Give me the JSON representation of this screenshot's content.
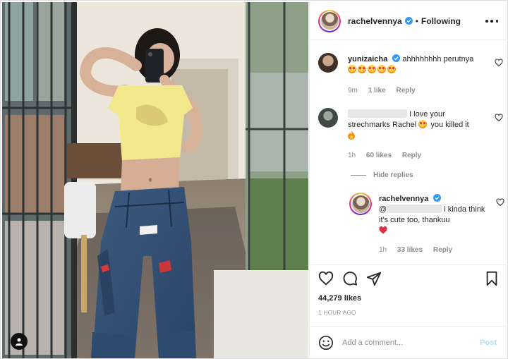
{
  "post": {
    "username": "rachelvennya",
    "separator": "•",
    "follow_status": "Following",
    "likes": "44,279 likes",
    "time_ago": "1 HOUR AGO"
  },
  "comments": [
    {
      "username": "yunizaicha",
      "text": "ahhhhhhhh perutnya",
      "emojis": [
        "star-struck",
        "star-struck",
        "star-struck",
        "star-struck",
        "star-struck"
      ],
      "time": "9m",
      "likes": "1 like",
      "reply_label": "Reply"
    },
    {
      "username": "",
      "text": "I love your strechmarks Rachel",
      "text_tail": "you killed it",
      "time": "1h",
      "likes": "60 likes",
      "reply_label": "Reply"
    },
    {
      "username": "rachelvennya",
      "mention": "@",
      "text": "i kinda think it's cute too, thankuu",
      "time": "1h",
      "likes": "33 likes",
      "reply_label": "Reply"
    }
  ],
  "hide_replies_label": "Hide replies",
  "add_comment": {
    "placeholder": "Add a comment...",
    "post_label": "Post"
  },
  "icons": {
    "heart": "heart-icon",
    "comment": "comment-icon",
    "share": "share-icon",
    "save": "bookmark-icon",
    "more": "more-options-icon",
    "emoji": "emoji-icon",
    "tag": "user-tag-icon"
  },
  "colors": {
    "verified": "#3897f0",
    "post_disabled": "#b2dffc",
    "like_red": "#ed4956"
  }
}
